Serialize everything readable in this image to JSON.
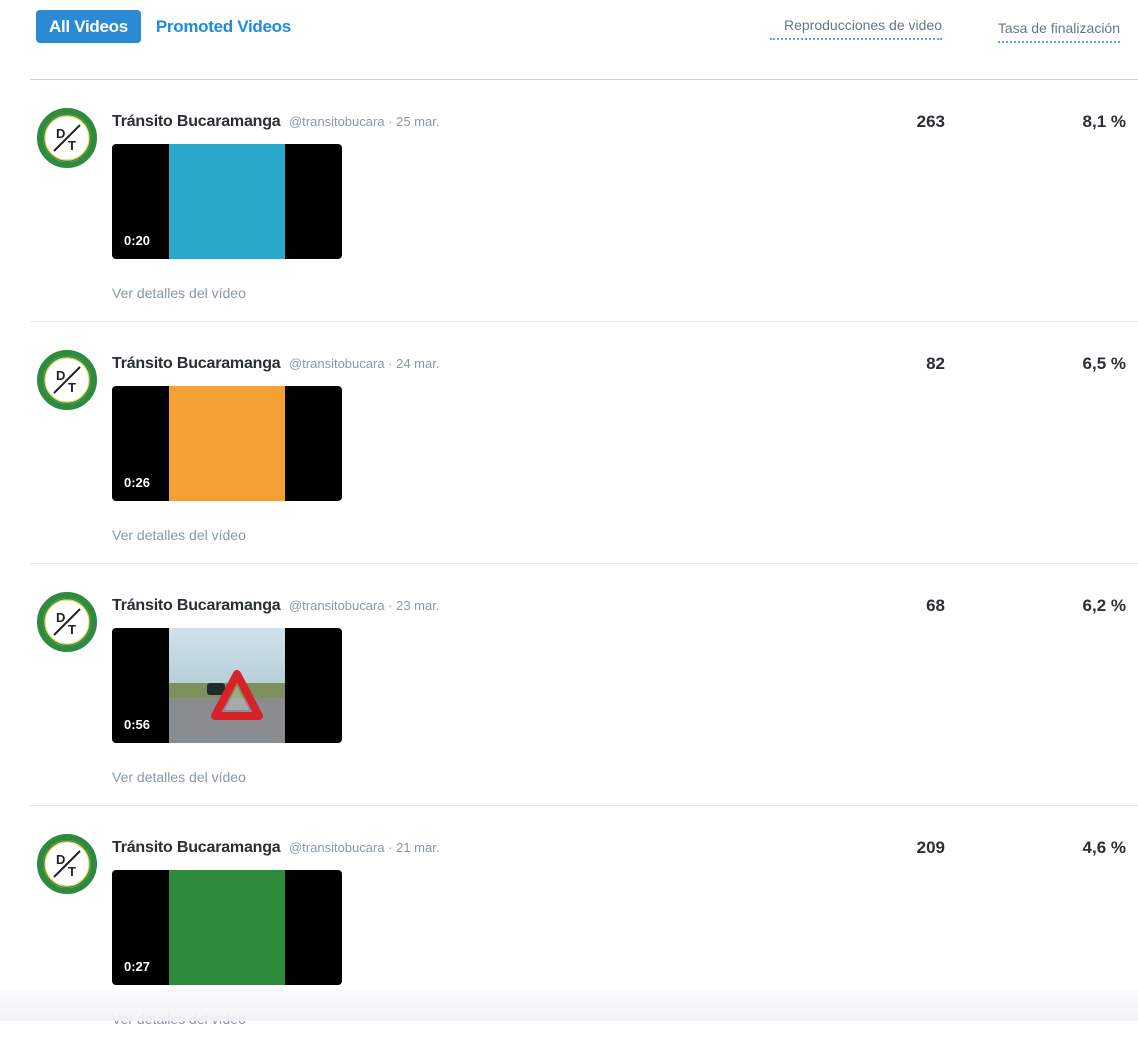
{
  "tabs": {
    "all": "All Videos",
    "promoted": "Promoted Videos"
  },
  "columns": {
    "plays": "Reproducciones de video",
    "completion": "Tasa de finalización"
  },
  "accent_color": "#2b8ad4",
  "rows": [
    {
      "name": "Tránsito Bucaramanga",
      "handle": "@transitobucara · 25 mar.",
      "duration": "0:20",
      "details": "Ver detalles del vídeo",
      "plays": "263",
      "rate": "8,1 %",
      "thumb_color": "#2aa8cc"
    },
    {
      "name": "Tránsito Bucaramanga",
      "handle": "@transitobucara · 24 mar.",
      "duration": "0:26",
      "details": "Ver detalles del vídeo",
      "plays": "82",
      "rate": "6,5 %",
      "thumb_color": "#f5a032"
    },
    {
      "name": "Tránsito Bucaramanga",
      "handle": "@transitobucara · 23 mar.",
      "duration": "0:56",
      "details": "Ver detalles del vídeo",
      "plays": "68",
      "rate": "6,2 %",
      "thumb_color": "#9fb9c5"
    },
    {
      "name": "Tránsito Bucaramanga",
      "handle": "@transitobucara · 21 mar.",
      "duration": "0:27",
      "details": "Ver detalles del vídeo",
      "plays": "209",
      "rate": "4,6 %",
      "thumb_color": "#2f8b3c"
    }
  ]
}
